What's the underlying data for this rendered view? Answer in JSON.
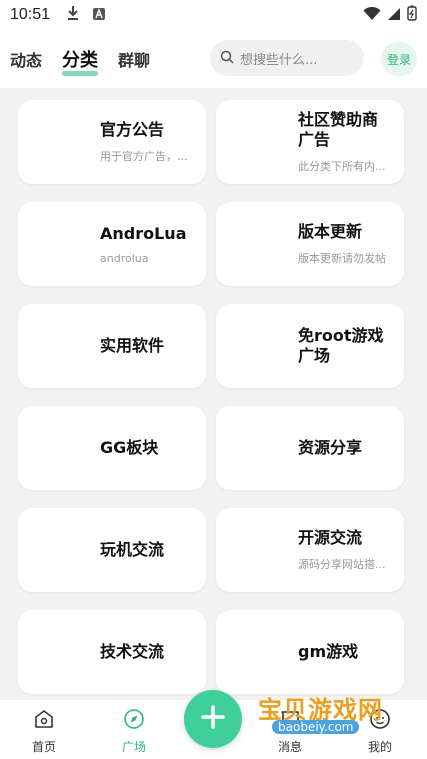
{
  "status_bar": {
    "time": "10:51"
  },
  "top_nav": {
    "tabs": [
      {
        "label": "动态"
      },
      {
        "label": "分类"
      },
      {
        "label": "群聊"
      }
    ],
    "search_placeholder": "想搜些什么...",
    "login_label": "登录"
  },
  "categories": [
    {
      "title": "官方公告",
      "desc": "用于官方广告，..."
    },
    {
      "title": "社区赞助商广告",
      "desc": "此分类下所有内..."
    },
    {
      "title": "AndroLua",
      "desc": "androlua"
    },
    {
      "title": "版本更新",
      "desc": "版本更新请勿发帖"
    },
    {
      "title": "实用软件",
      "desc": ""
    },
    {
      "title": "免root游戏广场",
      "desc": ""
    },
    {
      "title": "GG板块",
      "desc": ""
    },
    {
      "title": "资源分享",
      "desc": ""
    },
    {
      "title": "玩机交流",
      "desc": ""
    },
    {
      "title": "开源交流",
      "desc": "源码分享网站搭..."
    },
    {
      "title": "技术交流",
      "desc": ""
    },
    {
      "title": "gm游戏",
      "desc": ""
    }
  ],
  "bottom_nav": {
    "home": "首页",
    "square": "广场",
    "message": "消息",
    "mine": "我的"
  },
  "watermark": {
    "text": "宝贝游戏网",
    "url": "baobeiy.com"
  },
  "colors": {
    "accent": "#3ecf9a"
  }
}
